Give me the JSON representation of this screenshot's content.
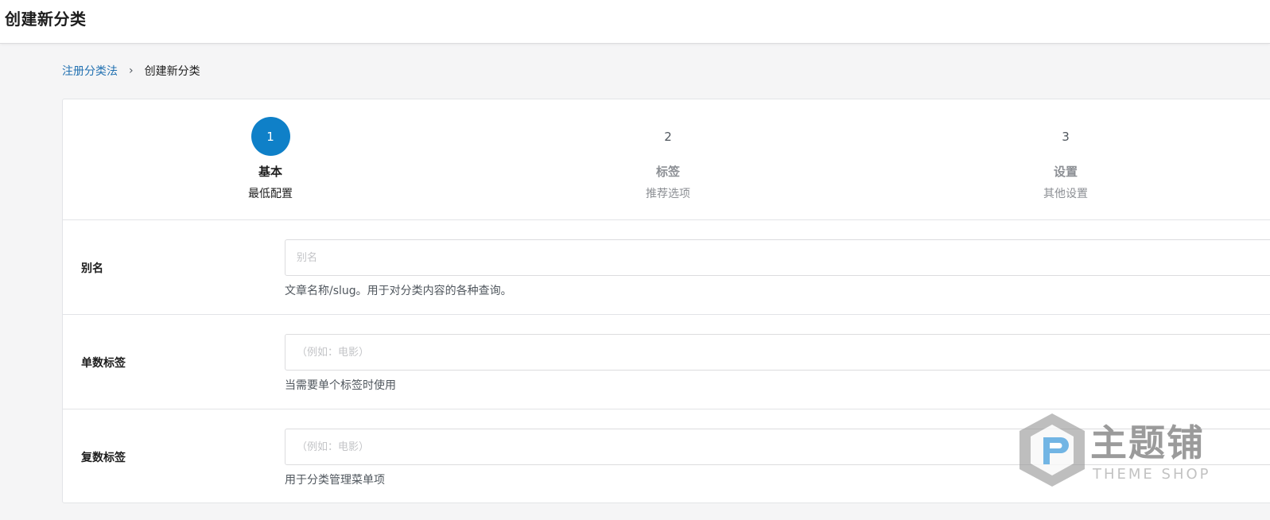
{
  "page": {
    "title": "创建新分类"
  },
  "breadcrumb": {
    "parent": "注册分类法",
    "separator": "›",
    "current": "创建新分类"
  },
  "steps": [
    {
      "number": "1",
      "title": "基本",
      "subtitle": "最低配置",
      "active": true
    },
    {
      "number": "2",
      "title": "标签",
      "subtitle": "推荐选项",
      "active": false
    },
    {
      "number": "3",
      "title": "设置",
      "subtitle": "其他设置",
      "active": false
    }
  ],
  "fields": [
    {
      "label": "别名",
      "placeholder": "别名",
      "value": "",
      "help": "文章名称/slug。用于对分类内容的各种查询。"
    },
    {
      "label": "单数标签",
      "placeholder": "（例如：电影）",
      "value": "",
      "help": "当需要单个标签时使用"
    },
    {
      "label": "复数标签",
      "placeholder": "（例如：电影）",
      "value": "",
      "help": "用于分类管理菜单项"
    }
  ],
  "watermark": {
    "main": "主题铺",
    "sub": "THEME SHOP"
  },
  "colors": {
    "accent": "#0f80c8",
    "link": "#2271b1",
    "border": "#e2e4e7",
    "background": "#f5f5f6"
  }
}
